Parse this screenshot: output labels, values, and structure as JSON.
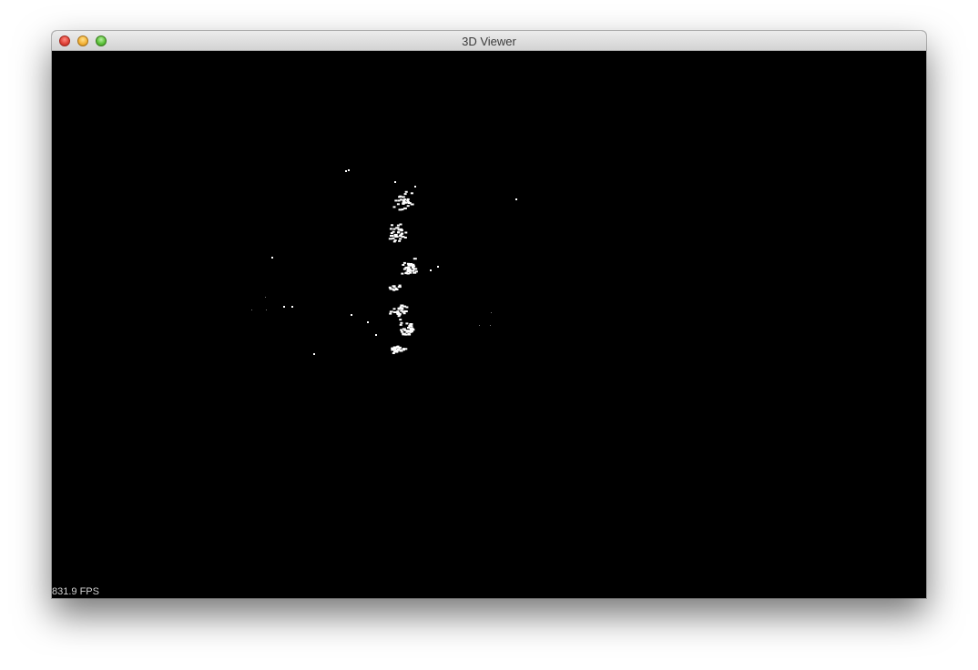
{
  "window": {
    "title": "3D Viewer"
  },
  "viewport": {
    "background": "#000000",
    "point_color": "#ffffff",
    "fps_label": "831.9 FPS"
  },
  "icons": {
    "close": "close-icon",
    "minimize": "minimize-icon",
    "zoom": "zoom-icon"
  }
}
